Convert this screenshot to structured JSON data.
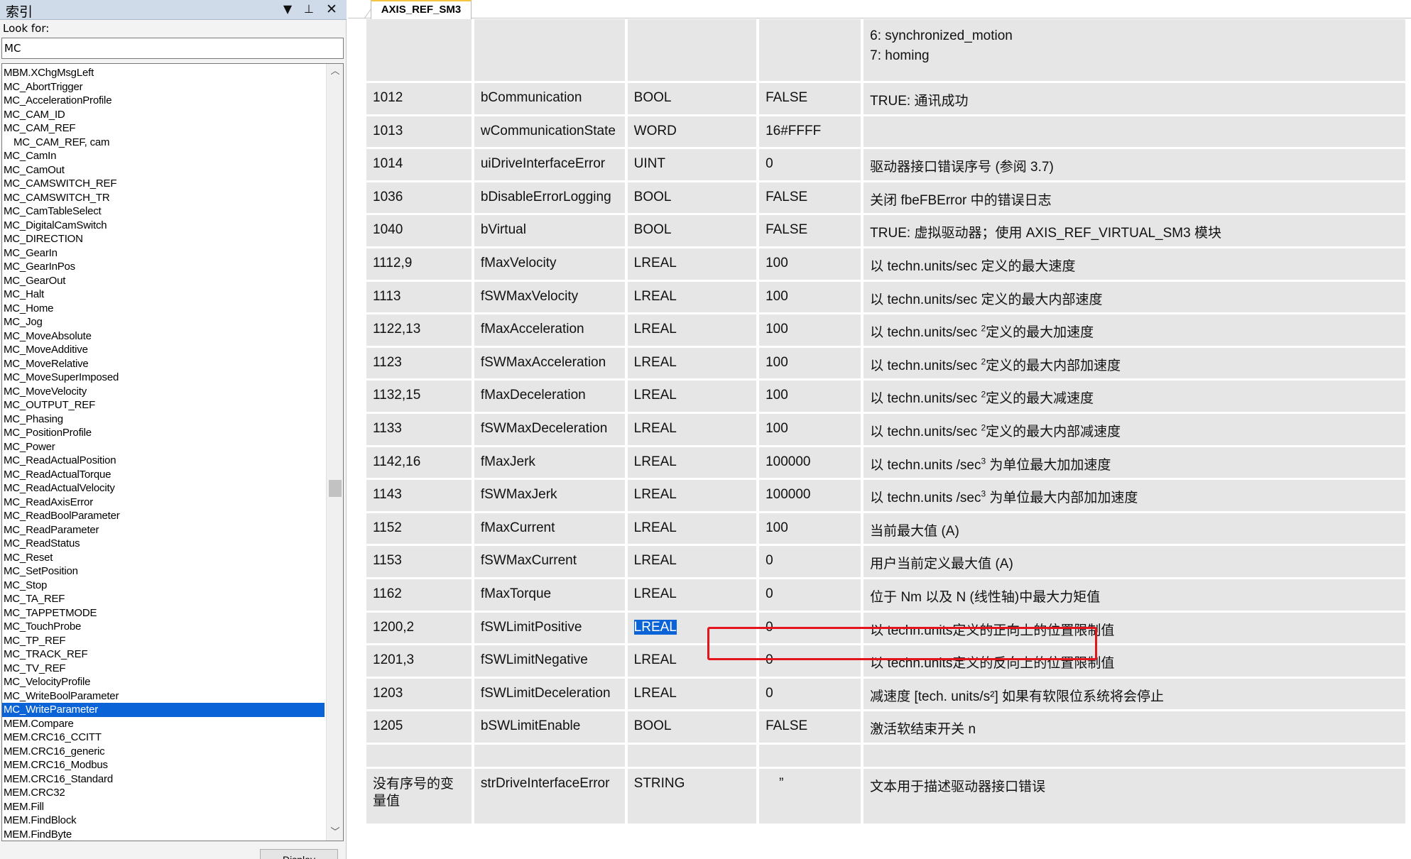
{
  "index_panel": {
    "title": "索引",
    "look_for_label": "Look for:",
    "search_value": "MC",
    "display_button": "Display",
    "items": [
      "MBM.XChgMsgLeft",
      "MC_AbortTrigger",
      "MC_AccelerationProfile",
      "MC_CAM_ID",
      "MC_CAM_REF",
      "MC_CAM_REF, cam",
      "MC_CamIn",
      "MC_CamOut",
      "MC_CAMSWITCH_REF",
      "MC_CAMSWITCH_TR",
      "MC_CamTableSelect",
      "MC_DigitalCamSwitch",
      "MC_DIRECTION",
      "MC_GearIn",
      "MC_GearInPos",
      "MC_GearOut",
      "MC_Halt",
      "MC_Home",
      "MC_Jog",
      "MC_MoveAbsolute",
      "MC_MoveAdditive",
      "MC_MoveRelative",
      "MC_MoveSuperImposed",
      "MC_MoveVelocity",
      "MC_OUTPUT_REF",
      "MC_Phasing",
      "MC_PositionProfile",
      "MC_Power",
      "MC_ReadActualPosition",
      "MC_ReadActualTorque",
      "MC_ReadActualVelocity",
      "MC_ReadAxisError",
      "MC_ReadBoolParameter",
      "MC_ReadParameter",
      "MC_ReadStatus",
      "MC_Reset",
      "MC_SetPosition",
      "MC_Stop",
      "MC_TA_REF",
      "MC_TAPPETMODE",
      "MC_TouchProbe",
      "MC_TP_REF",
      "MC_TRACK_REF",
      "MC_TV_REF",
      "MC_VelocityProfile",
      "MC_WriteBoolParameter",
      "MC_WriteParameter",
      "MEM.Compare",
      "MEM.CRC16_CCITT",
      "MEM.CRC16_generic",
      "MEM.CRC16_Modbus",
      "MEM.CRC16_Standard",
      "MEM.CRC32",
      "MEM.Fill",
      "MEM.FindBlock",
      "MEM.FindByte"
    ],
    "selected_item": "MC_WriteParameter"
  },
  "tab": {
    "label": "AXIS_REF_SM3"
  },
  "table": {
    "top_row": {
      "desc_line1": "6: synchronized_motion",
      "desc_line2": "7: homing"
    },
    "rows": [
      {
        "num": "1012",
        "name": "bCommunication",
        "type": "BOOL",
        "default": "FALSE",
        "desc": "TRUE: 通讯成功"
      },
      {
        "num": "1013",
        "name": "wCommunicationState",
        "type": "WORD",
        "default": "16#FFFF",
        "desc": ""
      },
      {
        "num": "1014",
        "name": "uiDriveInterfaceError",
        "type": "UINT",
        "default": "0",
        "desc": "驱动器接口错误序号 (参阅 3.7)"
      },
      {
        "num": "1036",
        "name": "bDisableErrorLogging",
        "type": "BOOL",
        "default": "FALSE",
        "desc": "关闭 fbeFBError 中的错误日志"
      },
      {
        "num": "1040",
        "name": "bVirtual",
        "type": "BOOL",
        "default": "FALSE",
        "desc": "TRUE: 虚拟驱动器；使用 AXIS_REF_VIRTUAL_SM3 模块"
      },
      {
        "num": "1112,9",
        "name": "fMaxVelocity",
        "type": "LREAL",
        "default": "100",
        "desc": "以 techn.units/sec 定义的最大速度"
      },
      {
        "num": "1113",
        "name": "fSWMaxVelocity",
        "type": "LREAL",
        "default": "100",
        "desc": "以 techn.units/sec 定义的最大内部速度"
      },
      {
        "num": "1122,13",
        "name": "fMaxAcceleration",
        "type": "LREAL",
        "default": "100",
        "desc_pre": "以 techn.units/sec ",
        "sup": "2",
        "desc_post": "定义的最大加速度"
      },
      {
        "num": "1123",
        "name": "fSWMaxAcceleration",
        "type": "LREAL",
        "default": "100",
        "desc_pre": "以 techn.units/sec ",
        "sup": "2",
        "desc_post": "定义的最大内部加速度"
      },
      {
        "num": "1132,15",
        "name": "fMaxDeceleration",
        "type": "LREAL",
        "default": "100",
        "desc_pre": "以 techn.units/sec ",
        "sup": "2",
        "desc_post": "定义的最大减速度"
      },
      {
        "num": "1133",
        "name": "fSWMaxDeceleration",
        "type": "LREAL",
        "default": "100",
        "desc_pre": "以 techn.units/sec ",
        "sup": "2",
        "desc_post": "定义的最大内部减速度"
      },
      {
        "num": "1142,16",
        "name": "fMaxJerk",
        "type": "LREAL",
        "default": "100000",
        "desc_pre": "以 techn.units /sec",
        "sup": "3",
        "desc_post": " 为单位最大加加速度"
      },
      {
        "num": "1143",
        "name": "fSWMaxJerk",
        "type": "LREAL",
        "default": "100000",
        "desc_pre": "以 techn.units /sec",
        "sup": "3",
        "desc_post": " 为单位最大内部加加速度"
      },
      {
        "num": "1152",
        "name": "fMaxCurrent",
        "type": "LREAL",
        "default": "100",
        "desc": "当前最大值 (A)"
      },
      {
        "num": "1153",
        "name": "fSWMaxCurrent",
        "type": "LREAL",
        "default": "0",
        "desc": "用户当前定义最大值 (A)"
      },
      {
        "num": "1162",
        "name": "fMaxTorque",
        "type": "LREAL",
        "default": "0",
        "desc": "位于 Nm 以及 N (线性轴)中最大力矩值"
      },
      {
        "num": "1200,2",
        "name": "fSWLimitPositive",
        "type": "LREAL",
        "default": "0",
        "desc": "以 techn.units定义的正向上的位置限制值",
        "selected_type": true
      },
      {
        "num": "1201,3",
        "name": "fSWLimitNegative",
        "type": "LREAL",
        "default": "0",
        "desc": "以 techn.units定义的反向上的位置限制值"
      },
      {
        "num": "1203",
        "name": "fSWLimitDeceleration",
        "type": "LREAL",
        "default": "0",
        "desc": "减速度 [tech. units/s²] 如果有软限位系统将会停止"
      },
      {
        "num": "1205",
        "name": "bSWLimitEnable",
        "type": "BOOL",
        "default": "FALSE",
        "desc": "激活软结束开关 n"
      }
    ],
    "last_row": {
      "num": "没有序号的变量值",
      "name": "strDriveInterfaceError",
      "type": "STRING",
      "default": "”",
      "desc": "文本用于描述驱动器接口错误"
    }
  },
  "colors": {
    "selection": "#0a64d8",
    "highlight_box": "#e4141c",
    "cell_bg": "#e6e6e6"
  }
}
